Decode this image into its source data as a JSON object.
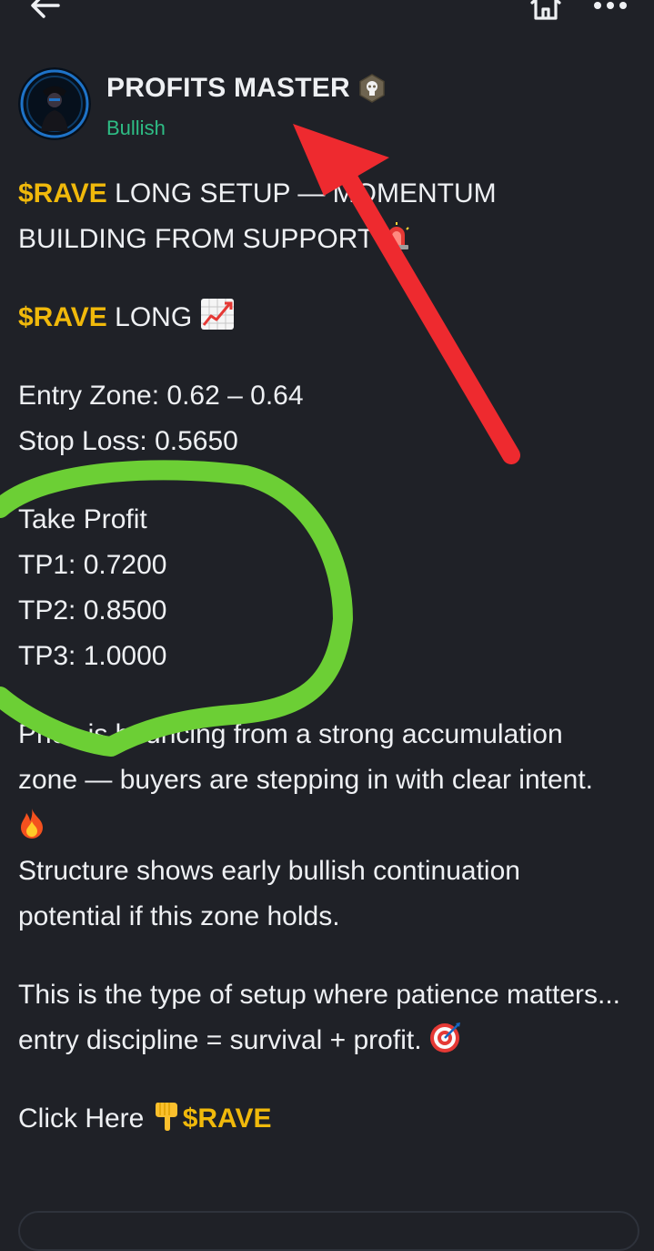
{
  "header": {
    "back_icon": "arrow-left-icon",
    "home_icon": "home-icon",
    "more_icon": "more-dots-icon"
  },
  "author": {
    "name": "PROFITS MASTER",
    "sentiment": "Bullish",
    "badge_icon": "verified-badge-icon",
    "sentiment_color": "#2ebd85"
  },
  "post": {
    "title": {
      "ticker": "$RAVE",
      "text": " LONG SETUP — MOMENTUM BUILDING FROM SUPPORT "
    },
    "signal": {
      "ticker": "$RAVE",
      "text": " LONG "
    },
    "entry_zone": "Entry Zone: 0.62 – 0.64",
    "stop_loss": "Stop Loss: 0.5650",
    "take_profit_heading": "Take Profit",
    "tp1": "TP1: 0.7200",
    "tp2": "TP2: 0.8500",
    "tp3": "TP3: 1.0000",
    "para1_line1": "Price is bouncing from a strong accumulation zone — buyers are stepping in with clear intent. ",
    "para1_line2": "Structure shows early bullish continuation potential if this zone holds.",
    "para2_line1": "This is the type of setup where patience matters...",
    "para2_line2": "entry discipline = survival + profit. ",
    "cta_text": "Click Here ",
    "cta_ticker": "$RAVE"
  },
  "colors": {
    "background": "#1f2127",
    "ticker": "#f0b90b",
    "text": "#eef0f3",
    "annotation_arrow": "#ee2a2f",
    "annotation_circle": "#6ccf35"
  }
}
